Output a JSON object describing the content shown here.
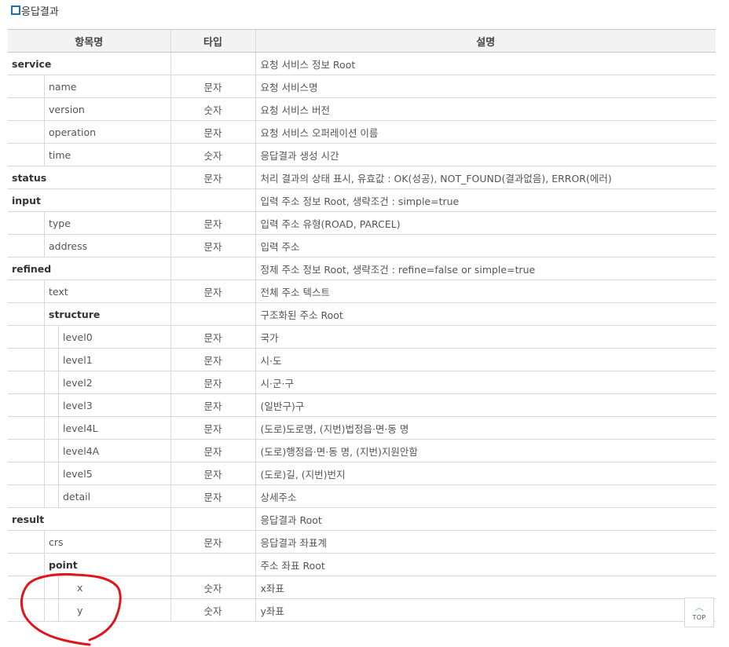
{
  "section": {
    "title": "응답결과"
  },
  "table": {
    "headers": {
      "name": "항목명",
      "type": "타입",
      "desc": "설명"
    },
    "rows": [
      {
        "name": "service",
        "level": 0,
        "bold": true,
        "type": "",
        "desc": "요청 서비스 정보 Root"
      },
      {
        "name": "name",
        "level": 1,
        "bold": false,
        "type": "문자",
        "desc": "요청 서비스명"
      },
      {
        "name": "version",
        "level": 1,
        "bold": false,
        "type": "숫자",
        "desc": "요청 서비스 버전"
      },
      {
        "name": "operation",
        "level": 1,
        "bold": false,
        "type": "문자",
        "desc": "요청 서비스 오퍼레이션 이름"
      },
      {
        "name": "time",
        "level": 1,
        "bold": false,
        "type": "숫자",
        "desc": "응답결과 생성 시간"
      },
      {
        "name": "status",
        "level": 0,
        "bold": true,
        "type": "문자",
        "desc": "처리 결과의 상태 표시, 유효값 : OK(성공), NOT_FOUND(결과없음), ERROR(에러)"
      },
      {
        "name": "input",
        "level": 0,
        "bold": true,
        "type": "",
        "desc": "입력 주소 정보 Root, 생략조건 : simple=true"
      },
      {
        "name": "type",
        "level": 1,
        "bold": false,
        "type": "문자",
        "desc": "입력 주소 유형(ROAD, PARCEL)"
      },
      {
        "name": "address",
        "level": 1,
        "bold": false,
        "type": "문자",
        "desc": "입력 주소"
      },
      {
        "name": "refined",
        "level": 0,
        "bold": true,
        "type": "",
        "desc": "정제 주소 정보 Root, 생략조건 : refine=false or simple=true"
      },
      {
        "name": "text",
        "level": 1,
        "bold": false,
        "type": "문자",
        "desc": "전체 주소 텍스트"
      },
      {
        "name": "structure",
        "level": 1,
        "bold": true,
        "type": "",
        "desc": "구조화된 주소 Root"
      },
      {
        "name": "level0",
        "level": 2,
        "bold": false,
        "type": "문자",
        "desc": "국가"
      },
      {
        "name": "level1",
        "level": 2,
        "bold": false,
        "type": "문자",
        "desc": "시·도"
      },
      {
        "name": "level2",
        "level": 2,
        "bold": false,
        "type": "문자",
        "desc": "시·군·구"
      },
      {
        "name": "level3",
        "level": 2,
        "bold": false,
        "type": "문자",
        "desc": "(일반구)구"
      },
      {
        "name": "level4L",
        "level": 2,
        "bold": false,
        "type": "문자",
        "desc": "(도로)도로명, (지번)법정읍·면·동 명"
      },
      {
        "name": "level4A",
        "level": 2,
        "bold": false,
        "type": "문자",
        "desc": "(도로)행정읍·면·동 명, (지번)지원안함"
      },
      {
        "name": "level5",
        "level": 2,
        "bold": false,
        "type": "문자",
        "desc": "(도로)길, (지번)번지"
      },
      {
        "name": "detail",
        "level": 2,
        "bold": false,
        "type": "문자",
        "desc": "상세주소"
      },
      {
        "name": "result",
        "level": 0,
        "bold": true,
        "type": "",
        "desc": "응답결과 Root"
      },
      {
        "name": "crs",
        "level": 1,
        "bold": false,
        "type": "문자",
        "desc": "응답결과 좌표계"
      },
      {
        "name": "point",
        "level": 1,
        "bold": true,
        "type": "",
        "desc": "주소 좌표 Root"
      },
      {
        "name": "x",
        "level": 3,
        "bold": false,
        "type": "숫자",
        "desc": "x좌표"
      },
      {
        "name": "y",
        "level": 3,
        "bold": false,
        "type": "숫자",
        "desc": "y좌표"
      }
    ]
  },
  "annotation": {
    "shape": "hand-drawn-circle",
    "color": "#e0151b",
    "target": "point"
  },
  "top_button": {
    "label": "TOP",
    "icon": "chevron-up-icon"
  }
}
